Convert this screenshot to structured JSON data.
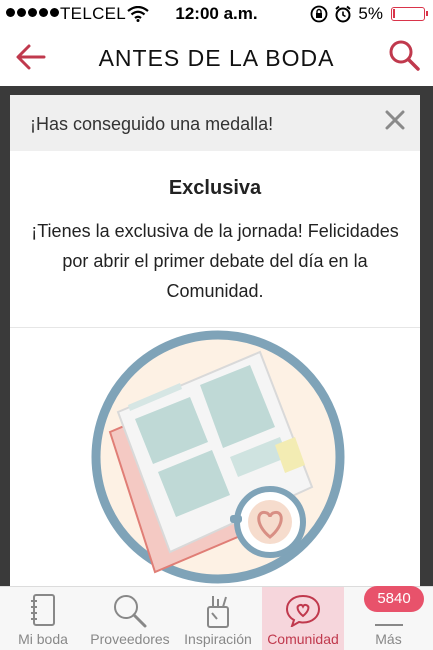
{
  "status_bar": {
    "carrier": "TELCEL",
    "time": "12:00 a.m.",
    "battery": "5%",
    "battery_level": 0.05,
    "icons": [
      "signal-dots-icon",
      "wifi-icon",
      "orientation-lock-icon",
      "alarm-icon",
      "battery-icon"
    ]
  },
  "header": {
    "title": "ANTES DE LA BODA",
    "back_icon": "arrow-left-icon",
    "search_icon": "search-icon",
    "accent_color": "#c0394d"
  },
  "modal": {
    "message": "¡Has conseguido una medalla!",
    "close_icon": "close-icon",
    "medal_title": "Exclusiva",
    "medal_description": "¡Tienes la exclusiva de la jornada! Felicidades por abrir el primer debate del día en la Comunidad.",
    "illustration": "newspaper-and-coffee-illustration"
  },
  "tab_bar": {
    "tabs": [
      {
        "label": "Mi boda",
        "icon": "notebook-icon",
        "active": false
      },
      {
        "label": "Proveedores",
        "icon": "magnifier-icon",
        "active": false
      },
      {
        "label": "Inspiración",
        "icon": "pencil-cup-icon",
        "active": false
      },
      {
        "label": "Comunidad",
        "icon": "heart-chat-icon",
        "active": true
      },
      {
        "label": "Más",
        "icon": "menu-icon",
        "active": false
      }
    ],
    "badge": "5840"
  },
  "colors": {
    "accent": "#c0394d",
    "badge": "#e8526b",
    "active_tab_bg": "#f6d6dc",
    "backdrop": "#3a3a3a"
  }
}
